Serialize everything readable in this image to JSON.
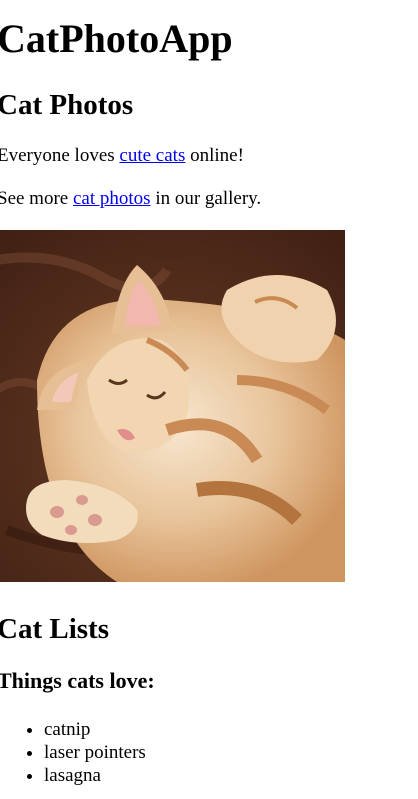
{
  "app_title": "CatPhotoApp",
  "photos_section": {
    "title": "Cat Photos",
    "para1": {
      "before": "Everyone loves ",
      "link": "cute cats",
      "after": " online!"
    },
    "para2": {
      "before": "See more ",
      "link": "cat photos",
      "after": " in our gallery."
    },
    "image_alt": "A cute orange cat lying on its back."
  },
  "lists_section": {
    "title": "Cat Lists",
    "subtitle": "Things cats love:",
    "items": [
      "catnip",
      "laser pointers",
      "lasagna"
    ]
  }
}
